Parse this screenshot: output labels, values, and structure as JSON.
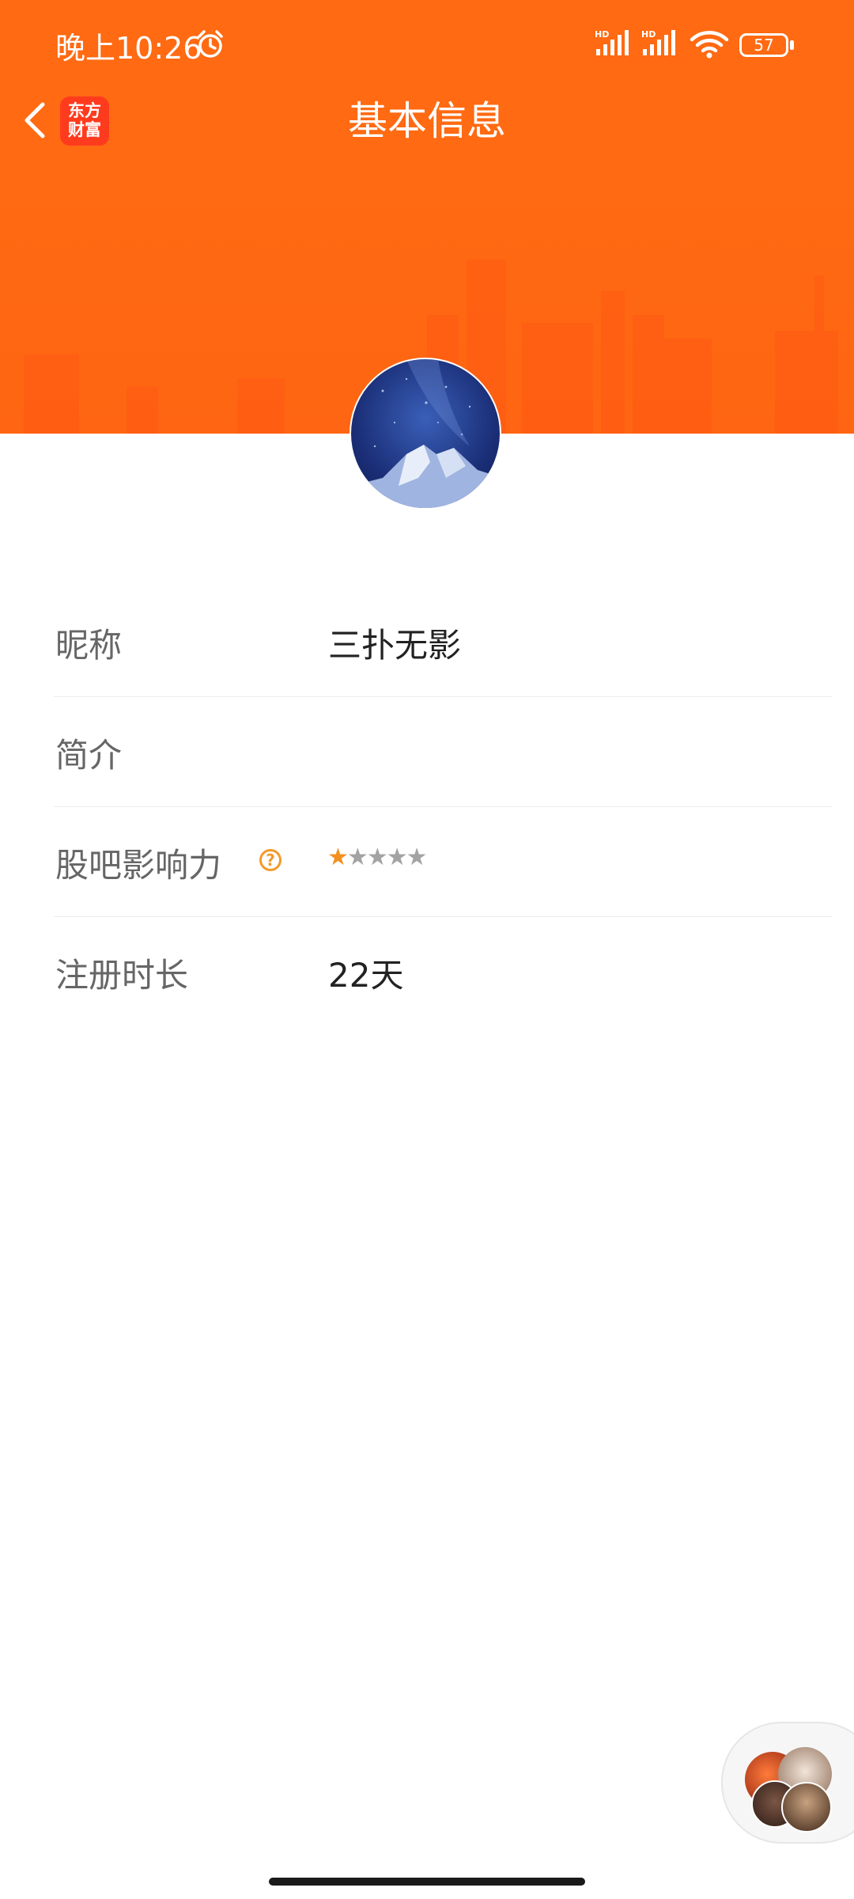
{
  "status_bar": {
    "time": "晚上10:26",
    "signal_1_label": "HD",
    "signal_2_label": "HD",
    "battery": "57"
  },
  "header": {
    "title": "基本信息",
    "app_badge_line1": "东方",
    "app_badge_line2": "财富",
    "accent_color": "#ff6a12"
  },
  "profile": {
    "rows": [
      {
        "label": "昵称",
        "value": "三扑无影"
      },
      {
        "label": "简介",
        "value": ""
      },
      {
        "label": "股吧影响力",
        "help_icon": "question-circle-icon",
        "rating": 1,
        "rating_max": 5
      },
      {
        "label": "注册时长",
        "value": "22天"
      }
    ]
  },
  "icons": {
    "back": "chevron-left-icon",
    "alarm": "alarm-clock-icon",
    "wifi": "wifi-icon",
    "help": "question-circle-icon"
  }
}
